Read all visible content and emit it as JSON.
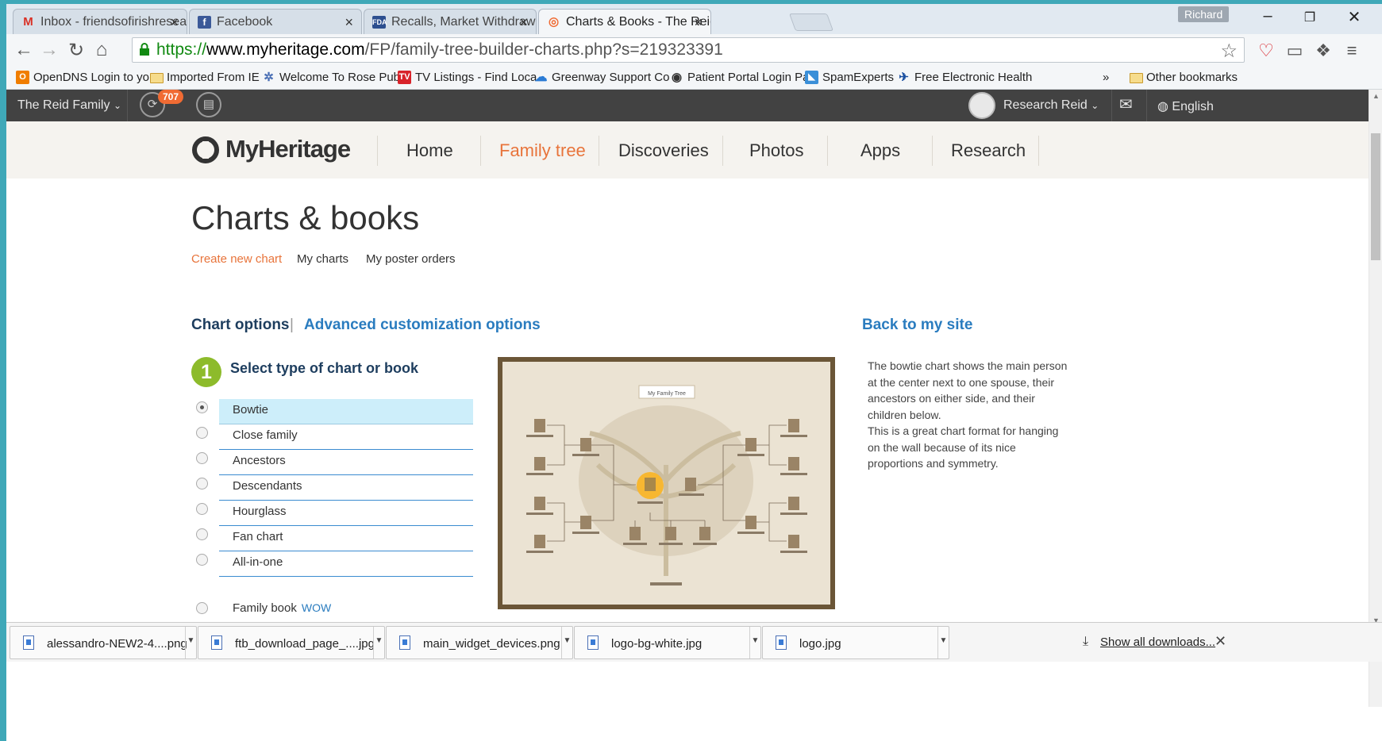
{
  "browser": {
    "tabs": [
      {
        "title": "Inbox - friendsofirishresea",
        "icon": "gmail-icon"
      },
      {
        "title": "Facebook",
        "icon": "facebook-icon"
      },
      {
        "title": "Recalls, Market Withdrawa",
        "icon": "fda-icon"
      },
      {
        "title": "Charts & Books - The Reid",
        "icon": "myheritage-icon",
        "active": true
      }
    ],
    "profile_name": "Richard",
    "url_scheme": "https://",
    "url_domain": "www.myheritage.com",
    "url_path": "/FP/family-tree-builder-charts.php?s=219323391",
    "bookmarks": [
      {
        "label": "OpenDNS Login to yo",
        "icon": "opendns-icon",
        "color": "#f07d00"
      },
      {
        "label": "Imported From IE",
        "icon": "folder-icon"
      },
      {
        "label": "Welcome To Rose Pub",
        "icon": "gear-globe-icon",
        "color": "#4a6fb5"
      },
      {
        "label": "TV Listings - Find Loca",
        "icon": "tv-icon",
        "color": "#d8232a"
      },
      {
        "label": "Greenway Support Co",
        "icon": "cloud-icon",
        "color": "#2a7bd5"
      },
      {
        "label": "Patient Portal Login Pa",
        "icon": "portal-icon",
        "color": "#333333"
      },
      {
        "label": "SpamExperts",
        "icon": "spamexperts-icon",
        "color": "#3a8fd8"
      },
      {
        "label": "Free Electronic Health",
        "icon": "health-icon",
        "color": "#1a4fa0"
      }
    ],
    "other_bookmarks": "Other bookmarks",
    "overflow": "»"
  },
  "site": {
    "family_site": "The Reid Family",
    "notification_count": "707",
    "user_name": "Research Reid",
    "language": "English",
    "logo_text": "MyHeritage",
    "nav": [
      "Home",
      "Family tree",
      "Discoveries",
      "Photos",
      "Apps",
      "Research"
    ],
    "active_nav": "Family tree"
  },
  "page": {
    "title": "Charts & books",
    "subnav": [
      "Create new chart",
      "My charts",
      "My poster orders"
    ],
    "chart_options": "Chart options",
    "separator": "|",
    "advanced": "Advanced customization options",
    "back": "Back to my site",
    "step_number": "1",
    "step_title": "Select type of chart or book",
    "chart_types": [
      "Bowtie",
      "Close family",
      "Ancestors",
      "Descendants",
      "Hourglass",
      "Fan chart",
      "All-in-one"
    ],
    "selected": "Bowtie",
    "family_book": "Family book",
    "family_book_badge": "WOW",
    "preview_title": "My Family Tree",
    "description": "The bowtie chart shows the main person at the center next to one spouse, their ancestors on either side, and their children below.",
    "description2": "This is a great chart format for hanging on the wall because of its nice proportions and symmetry."
  },
  "downloads": {
    "items": [
      "alessandro-NEW2-4....png",
      "ftb_download_page_....jpg",
      "main_widget_devices.png",
      "logo-bg-white.jpg",
      "logo.jpg"
    ],
    "show_all": "Show all downloads..."
  },
  "colors": {
    "accent_orange": "#e8743b",
    "link_blue": "#2a7cbf",
    "step_green": "#8dbb2b",
    "topbar": "#424242"
  }
}
